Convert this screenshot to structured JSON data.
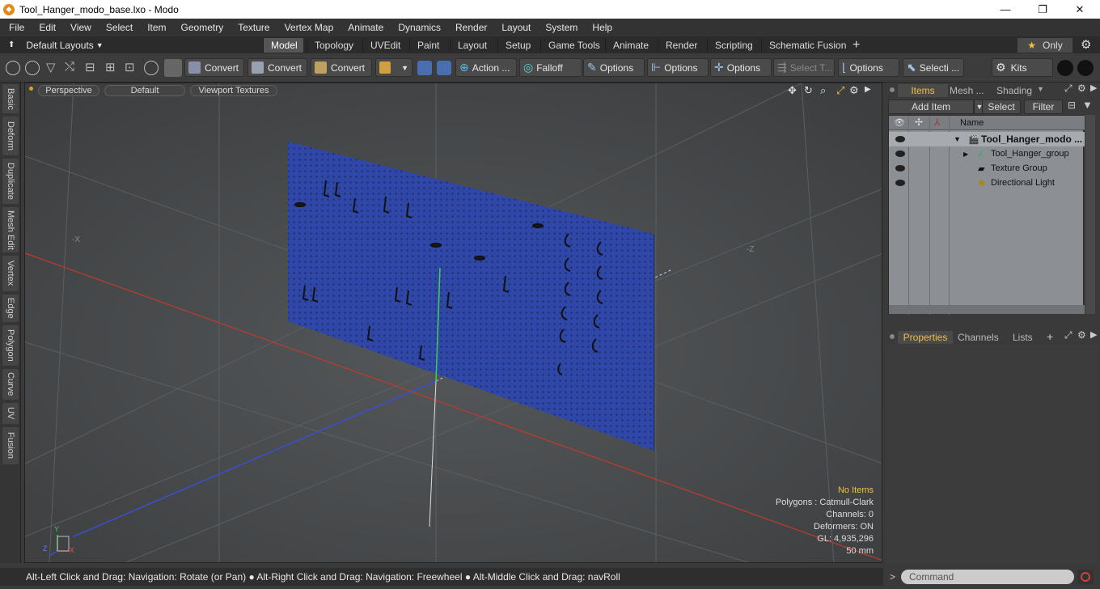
{
  "window": {
    "title": "Tool_Hanger_modo_base.lxo - Modo",
    "minimize": "—",
    "maximize": "❐",
    "close": "✕"
  },
  "menu": [
    "File",
    "Edit",
    "View",
    "Select",
    "Item",
    "Geometry",
    "Texture",
    "Vertex Map",
    "Animate",
    "Dynamics",
    "Render",
    "Layout",
    "System",
    "Help"
  ],
  "layoutbar": {
    "layout_label": "Default Layouts",
    "tabs": [
      "Model",
      "Topology",
      "UVEdit",
      "Paint",
      "Layout",
      "Setup",
      "Game Tools",
      "Animate",
      "Render",
      "Scripting",
      "Schematic Fusion"
    ],
    "active_tab": "Model",
    "add": "+",
    "only_label": "Only"
  },
  "toolbar": {
    "convert1": "Convert",
    "convert2": "Convert",
    "convert3": "Convert",
    "action": "Action ...",
    "falloff": "Falloff",
    "options1": "Options",
    "options2": "Options",
    "options3": "Options",
    "select_t": "Select T...",
    "options4": "Options",
    "selecti": "Selecti ...",
    "kits": "Kits"
  },
  "left_tabs": [
    "Basic",
    "Deform",
    "Duplicate",
    "Mesh Edit",
    "Vertex",
    "Edge",
    "Polygon",
    "Curve",
    "UV",
    "Fusion"
  ],
  "viewport": {
    "view": "Perspective",
    "shading": "Default",
    "textures": "Viewport Textures",
    "axis_x_neg": "-X",
    "axis_z_neg": "-Z",
    "gizmo_y": "Y",
    "gizmo_z": "Z",
    "gizmo_x": "X",
    "stats": {
      "items": "No Items",
      "polygons": "Polygons : Catmull-Clark",
      "channels": "Channels: 0",
      "deformers": "Deformers: ON",
      "gl": "GL: 4,935,296",
      "size": "50 mm"
    }
  },
  "status": "Alt-Left Click and Drag: Navigation: Rotate (or Pan) ● Alt-Right Click and Drag: Navigation: Freewheel ● Alt-Middle Click and Drag: navRoll",
  "items_panel": {
    "tabs": [
      "Items",
      "Mesh ...",
      "Shading"
    ],
    "add_item": "Add Item",
    "select": "Select",
    "filter": "Filter",
    "col_name": "Name",
    "rows": [
      {
        "label": "Tool_Hanger_modo ..."
      },
      {
        "label": "Tool_Hanger_group"
      },
      {
        "label": "Texture Group"
      },
      {
        "label": "Directional Light"
      }
    ]
  },
  "props_panel": {
    "tabs": [
      "Properties",
      "Channels",
      "Lists"
    ],
    "add": "+"
  },
  "command": {
    "placeholder": "Command",
    "prompt": ">"
  },
  "colors": {
    "accent": "#f0c040",
    "board": "#2f47a8",
    "grid_red": "#c0392b",
    "grid_blue": "#3b4fd0",
    "grid_green": "#3bd04f"
  }
}
